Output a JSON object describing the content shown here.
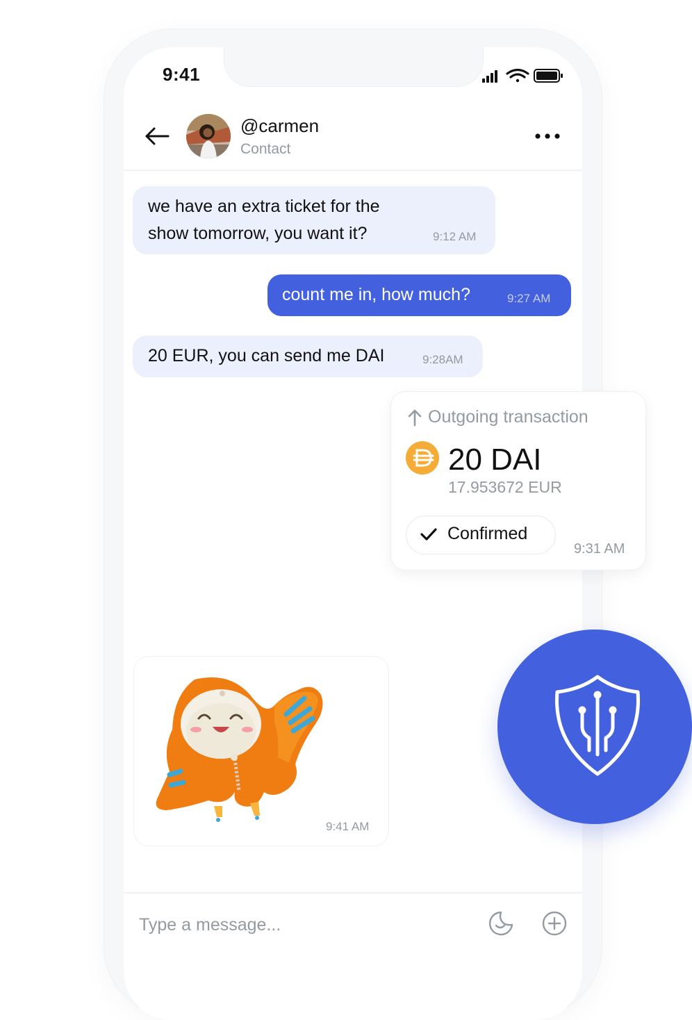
{
  "status_bar": {
    "time": "9:41",
    "signal_icon": "signal-icon",
    "wifi_icon": "wifi-icon",
    "battery_icon": "battery-icon"
  },
  "header": {
    "contact_name": "@carmen",
    "contact_subtitle": "Contact",
    "back_icon": "arrow-left-icon",
    "more_icon": "more-horizontal-icon"
  },
  "messages": [
    {
      "direction": "incoming",
      "text_line1": "we have an extra ticket for the",
      "text_line2": "show tomorrow, you want it?",
      "time": "9:12 AM"
    },
    {
      "direction": "outgoing",
      "text": "count me in, how much?",
      "time": "9:27 AM"
    },
    {
      "direction": "incoming",
      "text": "20 EUR, you can send me DAI",
      "time": "9:28AM"
    }
  ],
  "transaction": {
    "label": "Outgoing transaction",
    "amount": "20 DAI",
    "fiat": "17.953672 EUR",
    "status": "Confirmed",
    "time": "9:31 AM",
    "token_icon": "dai-icon",
    "token_color": "#F5AC37"
  },
  "sticker_message": {
    "time": "9:41 AM",
    "sticker": "orange-hooded-mascot"
  },
  "composer": {
    "placeholder": "Type a message...",
    "sticker_icon": "sticker-icon",
    "add_icon": "plus-circle-icon"
  },
  "badge": {
    "icon": "shield-circuit-icon"
  },
  "colors": {
    "accent": "#4360DF",
    "incoming_bubble": "#ECEFFC",
    "muted_text": "#939BA1"
  }
}
